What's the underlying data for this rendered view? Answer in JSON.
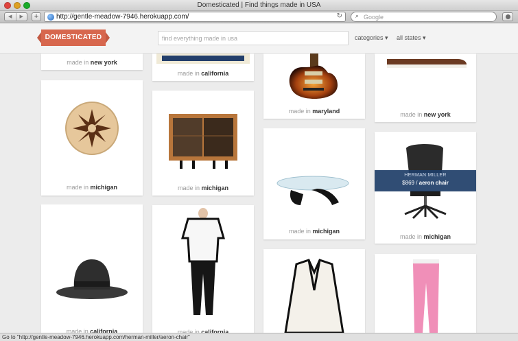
{
  "browser": {
    "window_title": "Domesticated | Find things made in USA",
    "url": "http://gentle-meadow-7946.herokuapp.com/",
    "search_placeholder": "Google",
    "back_glyph": "◀",
    "forward_glyph": "▶",
    "add_tab_glyph": "+",
    "reload_glyph": "↻",
    "status_text": "Go to \"http://gentle-meadow-7946.herokuapp.com/herman-miller/aeron-chair\""
  },
  "site": {
    "logo": "DOMESTICATED",
    "search_placeholder": "find everything made in usa",
    "nav": {
      "categories": "categories ▾",
      "all_states": "all states ▾"
    }
  },
  "labels": {
    "made_in": "made in"
  },
  "cards": [
    {
      "state": "new york"
    },
    {
      "state": "california"
    },
    {
      "state": "maryland"
    },
    {
      "state": "new york"
    },
    {
      "state": "michigan"
    },
    {
      "state": "michigan"
    },
    {
      "state": "michigan"
    },
    {
      "state": "michigan"
    },
    {
      "state": "california"
    },
    {
      "state": "california"
    }
  ],
  "featured": {
    "brand": "HERMAN MILLER",
    "price": "$869",
    "separator": "/",
    "name": "aeron chair"
  },
  "icons": {
    "traffic_lights": [
      "close-icon",
      "minimize-icon",
      "zoom-icon"
    ],
    "globe": "globe-icon",
    "search": "magnifier-icon",
    "download": "download-icon"
  }
}
